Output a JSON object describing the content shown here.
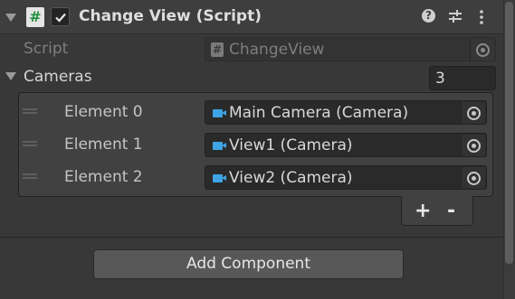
{
  "component": {
    "title": "Change View (Script)",
    "enabled": true,
    "icons": [
      "foldout-icon",
      "script-icon",
      "help-icon",
      "presets-icon",
      "more-icon"
    ]
  },
  "script_field": {
    "label": "Script",
    "value": "ChangeView"
  },
  "cameras": {
    "label": "Cameras",
    "size": "3",
    "elements": [
      {
        "label": "Element 0",
        "value": "Main Camera (Camera)"
      },
      {
        "label": "Element 1",
        "value": "View1 (Camera)"
      },
      {
        "label": "Element 2",
        "value": "View2 (Camera)"
      }
    ],
    "add_label": "+",
    "remove_label": "-"
  },
  "add_component_label": "Add Component",
  "colors": {
    "background": "#383838",
    "camera_icon": "#3ea4e6",
    "script_icon_hash": "#1f8f3c"
  }
}
